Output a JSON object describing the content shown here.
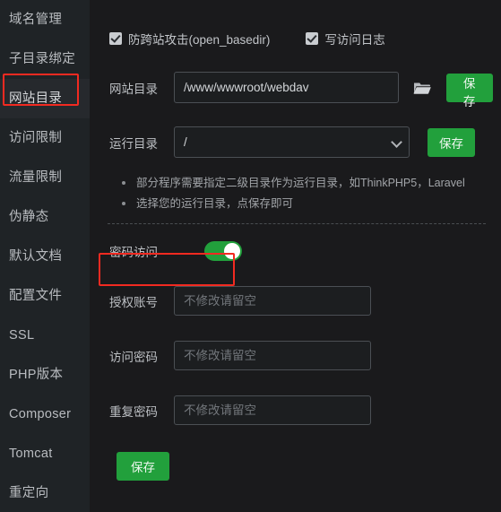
{
  "sidebar": {
    "items": [
      {
        "label": "域名管理",
        "active": false
      },
      {
        "label": "子目录绑定",
        "active": false
      },
      {
        "label": "网站目录",
        "active": true
      },
      {
        "label": "访问限制",
        "active": false
      },
      {
        "label": "流量限制",
        "active": false
      },
      {
        "label": "伪静态",
        "active": false
      },
      {
        "label": "默认文档",
        "active": false
      },
      {
        "label": "配置文件",
        "active": false
      },
      {
        "label": "SSL",
        "active": false
      },
      {
        "label": "PHP版本",
        "active": false
      },
      {
        "label": "Composer",
        "active": false
      },
      {
        "label": "Tomcat",
        "active": false
      },
      {
        "label": "重定向",
        "active": false
      }
    ]
  },
  "checkboxes": [
    {
      "label": "防跨站攻击(open_basedir)",
      "checked": true
    },
    {
      "label": "写访问日志",
      "checked": true
    }
  ],
  "website_dir": {
    "label": "网站目录",
    "value": "/www/wwwroot/webdav",
    "placeholder": "",
    "browse_icon": "folder-icon",
    "save_label": "保存"
  },
  "run_dir": {
    "label": "运行目录",
    "value": "/",
    "options": [
      "/"
    ],
    "dropdown_icon": "chevron-down-icon",
    "save_label": "保存"
  },
  "tips": [
    "部分程序需要指定二级目录作为运行目录，如ThinkPHP5，Laravel",
    "选择您的运行目录，点保存即可"
  ],
  "password_access": {
    "label": "密码访问",
    "enabled": true
  },
  "credentials": {
    "account": {
      "label": "授权账号",
      "value": "",
      "placeholder": "不修改请留空"
    },
    "password": {
      "label": "访问密码",
      "value": "",
      "placeholder": "不修改请留空"
    },
    "repeat_password": {
      "label": "重复密码",
      "value": "",
      "placeholder": "不修改请留空"
    }
  },
  "submit": {
    "save_label": "保存"
  },
  "colors": {
    "accent_green": "#22a03c",
    "annotation_red": "#f22a21",
    "sidebar_bg": "#1f2326",
    "content_bg": "#1a1a1c"
  }
}
